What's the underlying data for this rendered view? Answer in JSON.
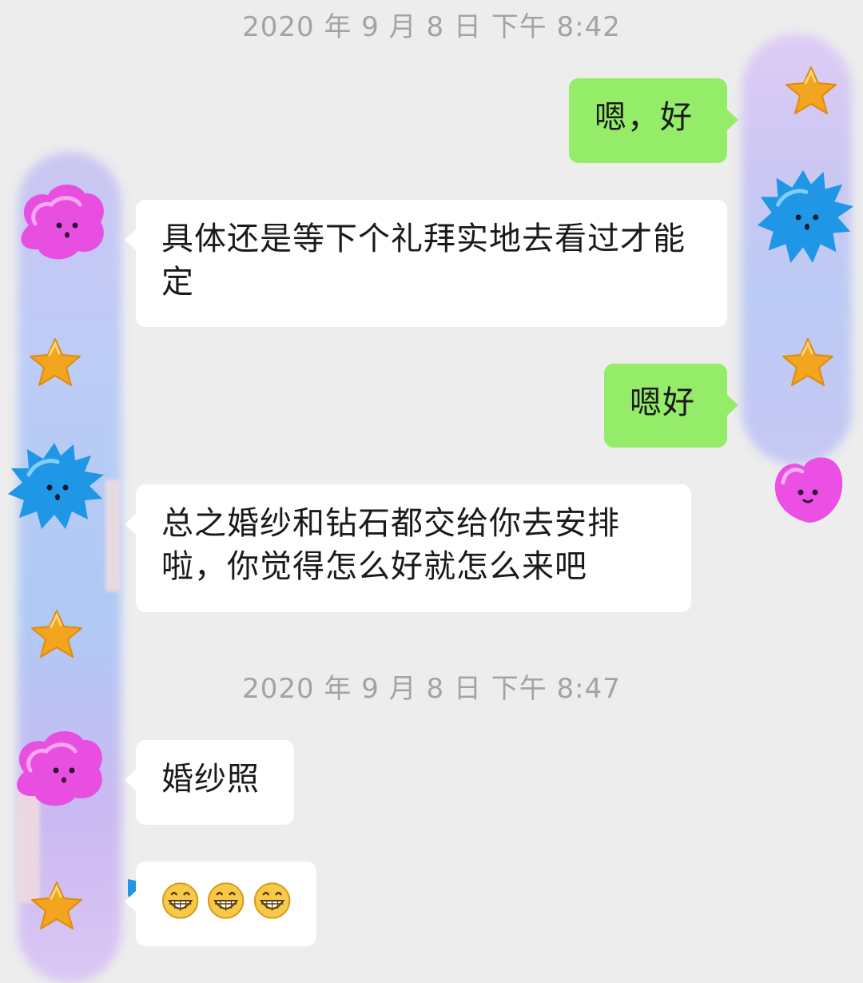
{
  "timestamps": [
    "2020 年 9 月 8 日  下午 8:42",
    "2020 年 9 月 8 日  下午 8:47"
  ],
  "messages": [
    {
      "side": "out",
      "text": "嗯，好"
    },
    {
      "side": "in",
      "text": "具体还是等下个礼拜实地去看过才能定"
    },
    {
      "side": "out",
      "text": "嗯好"
    },
    {
      "side": "in",
      "text": "总之婚纱和钻石都交给你去安排啦，你觉得怎么好就怎么来吧"
    },
    {
      "side": "in",
      "text": "婚纱照"
    },
    {
      "side": "in",
      "emojis": [
        "grin-emoji",
        "grin-emoji",
        "grin-emoji"
      ]
    }
  ],
  "colors": {
    "background": "#ededed",
    "outgoing_bubble": "#95ec69",
    "incoming_bubble": "#ffffff",
    "timestamp": "#a3a3a3"
  }
}
